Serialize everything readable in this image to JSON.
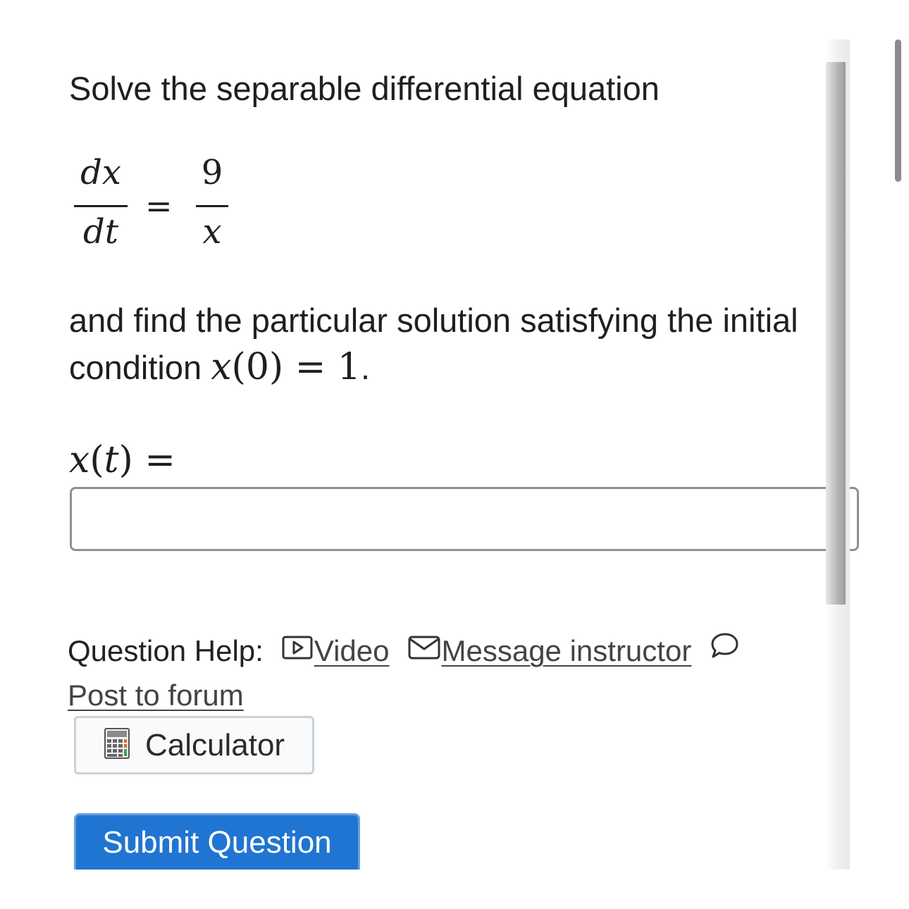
{
  "question": {
    "intro": "Solve the separable differential equation",
    "equation": {
      "lhs_num": "dx",
      "lhs_den": "dt",
      "equals": "=",
      "rhs_num": "9",
      "rhs_den": "x"
    },
    "text_before_condition": "and find the particular solution satisfying the initial condition ",
    "condition": {
      "fn": "x",
      "open": "(",
      "arg": "0",
      "close": ")",
      "equals": " = ",
      "value": "1",
      "end": "."
    }
  },
  "answer": {
    "label_fn": "x",
    "label_open": "(",
    "label_arg": "t",
    "label_close": ")",
    "label_equals": " =",
    "value": "",
    "placeholder": ""
  },
  "help": {
    "label": "Question Help:",
    "links": {
      "video": "Video",
      "message": "Message instructor",
      "forum": "Post to forum"
    },
    "icons": [
      "video-icon",
      "message-icon",
      "forum-icon"
    ]
  },
  "buttons": {
    "calculator": "Calculator",
    "submit": "Submit Question"
  },
  "colors": {
    "primary": "#1f75d1",
    "text": "#1f1f1f",
    "link": "#444444",
    "input_border": "#8f8f8f"
  }
}
